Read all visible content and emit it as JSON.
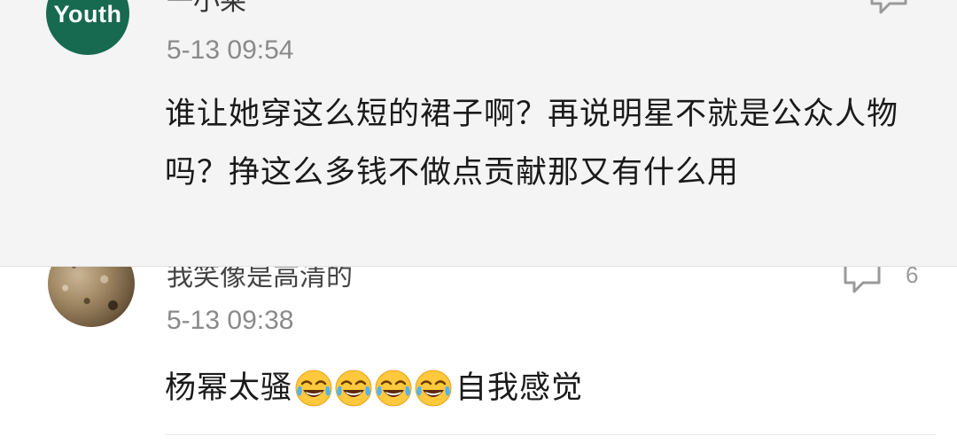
{
  "comments": [
    {
      "avatar": {
        "text": "Youth",
        "color": "#17694f"
      },
      "username": "一小莱",
      "timestamp": "5-13 09:54",
      "text": "谁让她穿这么短的裙子啊？再说明星不就是公众人物吗？挣这么多钱不做点贡献那又有什么用",
      "reply_icon": "comment-icon"
    },
    {
      "avatar": {
        "icon": "textured-photo-avatar"
      },
      "username": "我笑像是高清的",
      "timestamp": "5-13 09:38",
      "text_before": "杨幂太骚",
      "emoji": [
        "tears-of-joy-emoji",
        "tears-of-joy-emoji",
        "tears-of-joy-emoji",
        "tears-of-joy-emoji"
      ],
      "text_after": "自我感觉",
      "reply_icon": "comment-icon",
      "reply_count": "6"
    }
  ],
  "colors": {
    "highlight_background": "#f4f4f4",
    "timestamp": "#8a8a8a",
    "text": "#1a1a1a"
  }
}
